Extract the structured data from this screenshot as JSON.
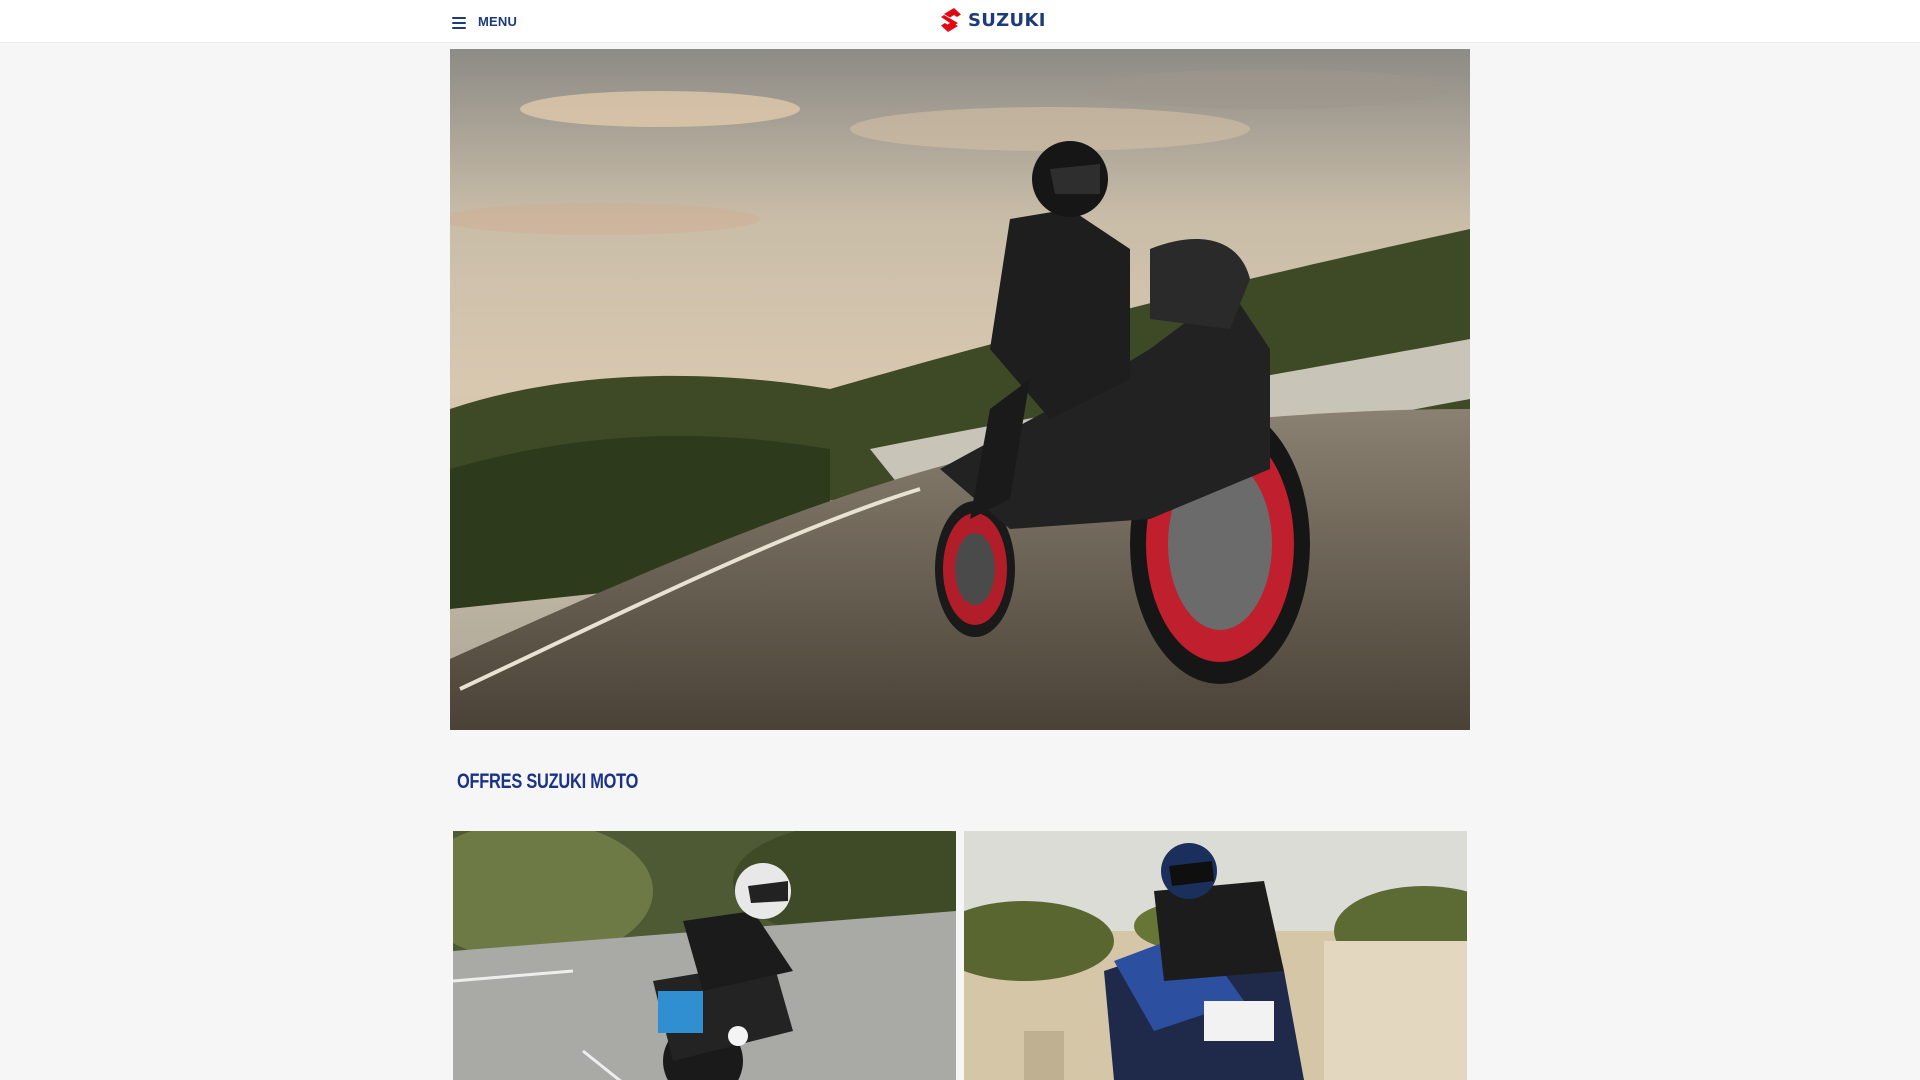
{
  "header": {
    "menu_label": "MENU",
    "menu_icon": "hamburger-icon",
    "logo_text": "SUZUKI",
    "logo_icon": "suzuki-s-logo-icon",
    "brand_red": "#e30613",
    "brand_blue": "#1d3a7b"
  },
  "hero": {
    "image": "rider-on-suzuki-motorcycle-cornering-road"
  },
  "offers": {
    "title": "OFFRES SUZUKI MOTO",
    "cards": [
      {
        "image": "rider-on-blue-suzuki-naked-bike"
      },
      {
        "image": "rider-on-blue-white-suzuki-sport-touring-bike"
      }
    ]
  }
}
